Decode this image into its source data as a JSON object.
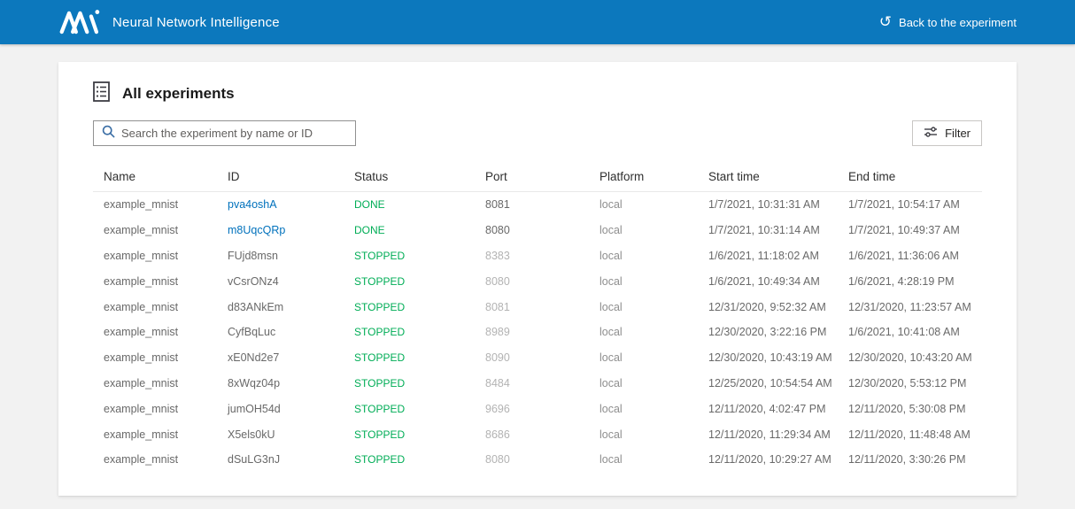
{
  "header": {
    "brand": "Neural Network Intelligence",
    "back_label": "Back to the experiment",
    "back_glyph": "↺"
  },
  "panel": {
    "title": "All experiments",
    "search_placeholder": "Search the experiment by name or ID",
    "filter_label": "Filter"
  },
  "icons": {
    "brand": "nni-zigzag-logo",
    "back": "return-arrow",
    "title": "bulleted-document",
    "search": "magnifier",
    "filter": "sliders"
  },
  "colors": {
    "topbar_blue": "#0c78bd",
    "link_blue": "#0071bc",
    "status_green": "#00ad56",
    "page_background": "#f2f2f2"
  },
  "table": {
    "columns": [
      "Name",
      "ID",
      "Status",
      "Port",
      "Platform",
      "Start time",
      "End time"
    ],
    "rows": [
      {
        "name": "example_mnist",
        "id": "pva4oshA",
        "status": "DONE",
        "port": "8081",
        "platform": "local",
        "start": "1/7/2021, 10:31:31 AM",
        "end": "1/7/2021, 10:54:17 AM"
      },
      {
        "name": "example_mnist",
        "id": "m8UqcQRp",
        "status": "DONE",
        "port": "8080",
        "platform": "local",
        "start": "1/7/2021, 10:31:14 AM",
        "end": "1/7/2021, 10:49:37 AM"
      },
      {
        "name": "example_mnist",
        "id": "FUjd8msn",
        "status": "STOPPED",
        "port": "8383",
        "platform": "local",
        "start": "1/6/2021, 11:18:02 AM",
        "end": "1/6/2021, 11:36:06 AM"
      },
      {
        "name": "example_mnist",
        "id": "vCsrONz4",
        "status": "STOPPED",
        "port": "8080",
        "platform": "local",
        "start": "1/6/2021, 10:49:34 AM",
        "end": "1/6/2021, 4:28:19 PM"
      },
      {
        "name": "example_mnist",
        "id": "d83ANkEm",
        "status": "STOPPED",
        "port": "8081",
        "platform": "local",
        "start": "12/31/2020, 9:52:32 AM",
        "end": "12/31/2020, 11:23:57 AM"
      },
      {
        "name": "example_mnist",
        "id": "CyfBqLuc",
        "status": "STOPPED",
        "port": "8989",
        "platform": "local",
        "start": "12/30/2020, 3:22:16 PM",
        "end": "1/6/2021, 10:41:08 AM"
      },
      {
        "name": "example_mnist",
        "id": "xE0Nd2e7",
        "status": "STOPPED",
        "port": "8090",
        "platform": "local",
        "start": "12/30/2020, 10:43:19 AM",
        "end": "12/30/2020, 10:43:20 AM"
      },
      {
        "name": "example_mnist",
        "id": "8xWqz04p",
        "status": "STOPPED",
        "port": "8484",
        "platform": "local",
        "start": "12/25/2020, 10:54:54 AM",
        "end": "12/30/2020, 5:53:12 PM"
      },
      {
        "name": "example_mnist",
        "id": "jumOH54d",
        "status": "STOPPED",
        "port": "9696",
        "platform": "local",
        "start": "12/11/2020, 4:02:47 PM",
        "end": "12/11/2020, 5:30:08 PM"
      },
      {
        "name": "example_mnist",
        "id": "X5els0kU",
        "status": "STOPPED",
        "port": "8686",
        "platform": "local",
        "start": "12/11/2020, 11:29:34 AM",
        "end": "12/11/2020, 11:48:48 AM"
      },
      {
        "name": "example_mnist",
        "id": "dSuLG3nJ",
        "status": "STOPPED",
        "port": "8080",
        "platform": "local",
        "start": "12/11/2020, 10:29:27 AM",
        "end": "12/11/2020, 3:30:26 PM"
      }
    ]
  }
}
